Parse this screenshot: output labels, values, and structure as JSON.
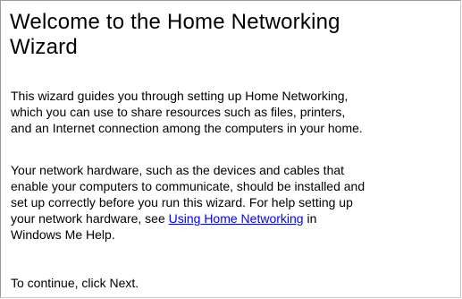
{
  "wizard": {
    "title_line1": "Welcome to the Home Networking",
    "title_line2": "Wizard",
    "intro_paragraph": {
      "line1": "This wizard guides you through setting up Home Networking,",
      "line2": "which you can use to share resources such as files, printers,",
      "line3": "and an Internet connection among the computers in your home."
    },
    "hardware_paragraph": {
      "line1": "Your network hardware, such as the devices and cables that",
      "line2": "enable your computers to communicate, should be installed and",
      "line3": "set up correctly before you run this wizard. For help setting up",
      "line4_before_link": "your network hardware, see ",
      "link_text": "Using Home Networking",
      "line4_after_link": " in",
      "line5": "Windows Me Help."
    },
    "continue_text": "To continue, click Next.",
    "colors": {
      "link": "#0000ff",
      "text": "#000000",
      "background": "#ffffff"
    }
  }
}
